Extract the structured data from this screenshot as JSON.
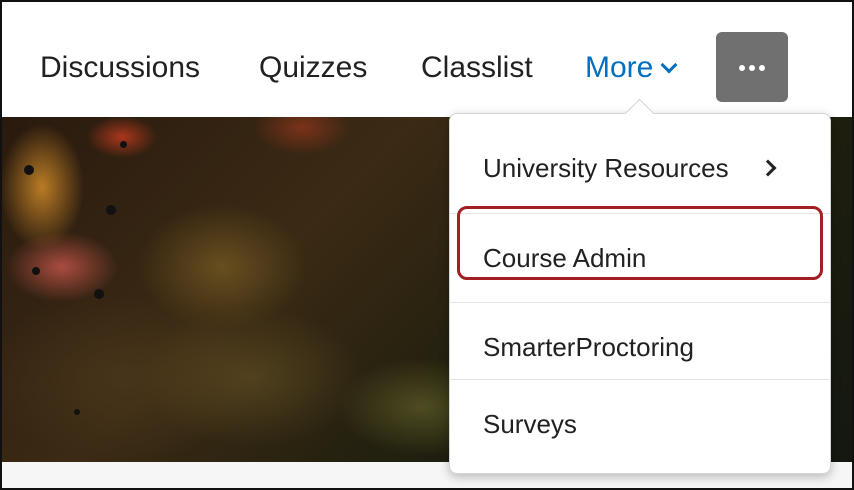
{
  "navbar": {
    "items": [
      {
        "label": "Discussions"
      },
      {
        "label": "Quizzes"
      },
      {
        "label": "Classlist"
      }
    ],
    "more_label": "More",
    "more_icon": "chevron-down-icon",
    "overflow_icon": "ellipsis-icon"
  },
  "dropdown": {
    "items": [
      {
        "label": "University Resources",
        "icon": "chevron-right-icon"
      },
      {
        "label": "Course Admin",
        "highlighted": true
      },
      {
        "label": "SmarterProctoring"
      },
      {
        "label": "Surveys"
      }
    ]
  },
  "colors": {
    "link": "#006fbf",
    "text": "#202122",
    "overflow_button": "#707070",
    "highlight": "#a31f24"
  }
}
